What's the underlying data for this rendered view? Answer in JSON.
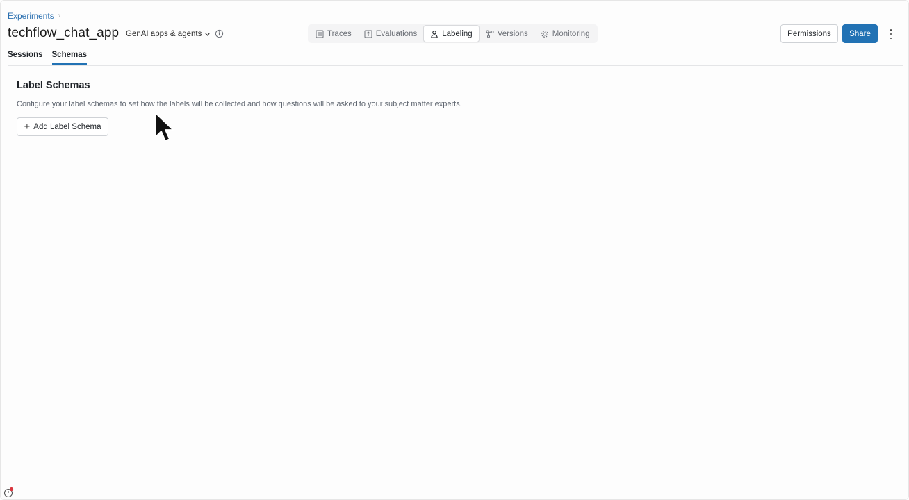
{
  "breadcrumb": {
    "root": "Experiments",
    "separator": "›"
  },
  "header": {
    "title": "techflow_chat_app",
    "type_dropdown": "GenAI apps & agents",
    "permissions_label": "Permissions",
    "share_label": "Share"
  },
  "mode_tabs": [
    {
      "label": "Traces",
      "icon": "list-icon"
    },
    {
      "label": "Evaluations",
      "icon": "upload-box-icon"
    },
    {
      "label": "Labeling",
      "icon": "person-icon",
      "active": true
    },
    {
      "label": "Versions",
      "icon": "nodes-icon"
    },
    {
      "label": "Monitoring",
      "icon": "gear-icon"
    }
  ],
  "sub_tabs": [
    {
      "label": "Sessions"
    },
    {
      "label": "Schemas",
      "active": true
    }
  ],
  "content": {
    "title": "Label Schemas",
    "description": "Configure your label schemas to set how the labels will be collected and how questions will be asked to your subject matter experts.",
    "add_button": "Add Label Schema"
  },
  "colors": {
    "accent": "#2272b4",
    "link": "#2a6fb0"
  }
}
